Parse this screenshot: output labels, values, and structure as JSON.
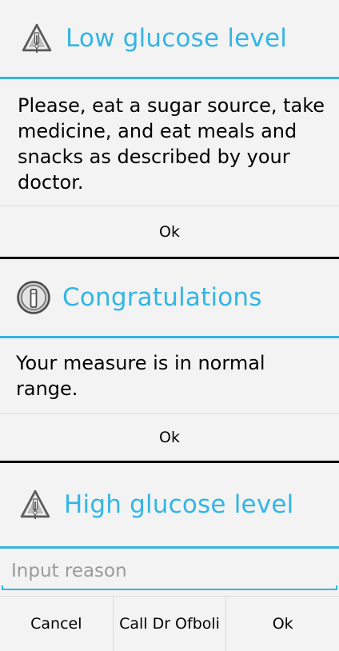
{
  "colors": {
    "accent": "#33b5e5",
    "dialog_background": "#f3f3f3",
    "screen_background": "#000000",
    "placeholder": "#9b9b9b"
  },
  "dialogs": {
    "low": {
      "icon": "warning-icon",
      "title": "Low glucose level",
      "message": "Please, eat a sugar source, take medicine, and eat meals and snacks as described by your doctor.",
      "ok_label": "Ok"
    },
    "congrats": {
      "icon": "info-icon",
      "title": "Congratulations",
      "message": "Your measure is in normal range.",
      "ok_label": "Ok"
    },
    "high": {
      "icon": "warning-icon",
      "title": "High glucose level",
      "input": {
        "value": "",
        "placeholder": "Input reason"
      },
      "cancel_label": "Cancel",
      "call_label": "Call Dr Ofboli",
      "ok_label": "Ok"
    }
  }
}
